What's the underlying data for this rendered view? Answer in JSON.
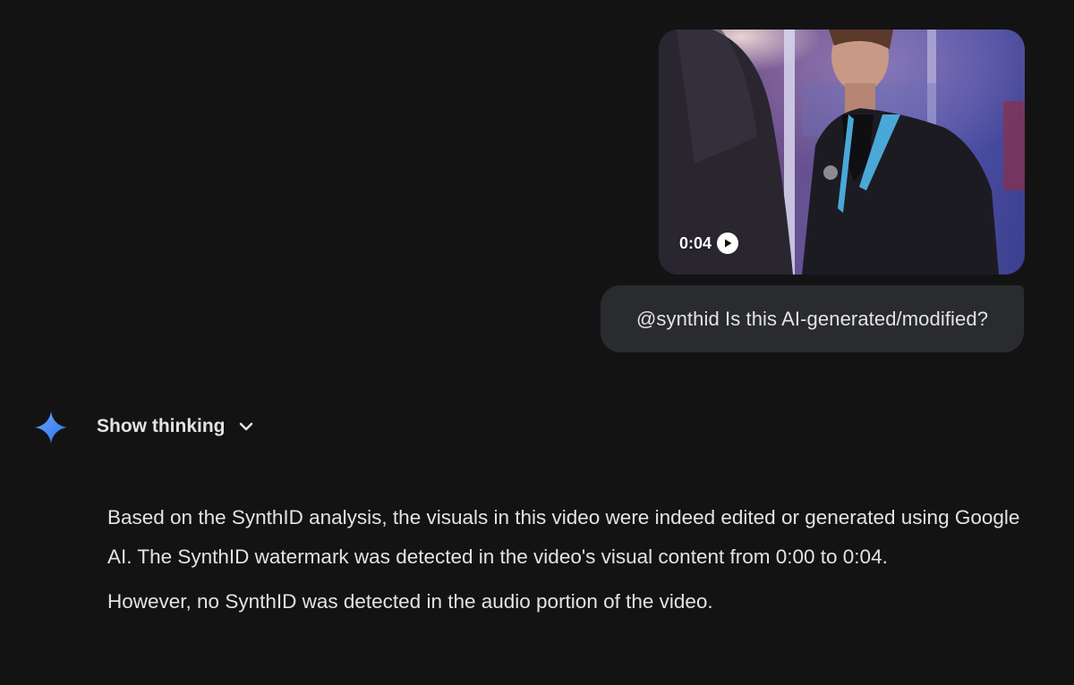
{
  "user_message": {
    "video": {
      "duration": "0:04",
      "play_icon": "play-circle-icon"
    },
    "text": "@synthid Is this AI-generated/modified?"
  },
  "model_response": {
    "icon": "gemini-sparkle-icon",
    "show_thinking_label": "Show thinking",
    "show_thinking_icon": "chevron-down-icon",
    "paragraphs": [
      "Based on the SynthID analysis, the visuals in this video were indeed edited or generated using Google AI. The SynthID watermark was detected in the video's visual content from 0:00 to 0:04.",
      "However, no SynthID was detected in the audio portion of the video."
    ]
  },
  "colors": {
    "background": "#131314",
    "bubble": "#2a2b2e",
    "text": "#e3e3e3",
    "accent_blue": "#4285f4"
  }
}
